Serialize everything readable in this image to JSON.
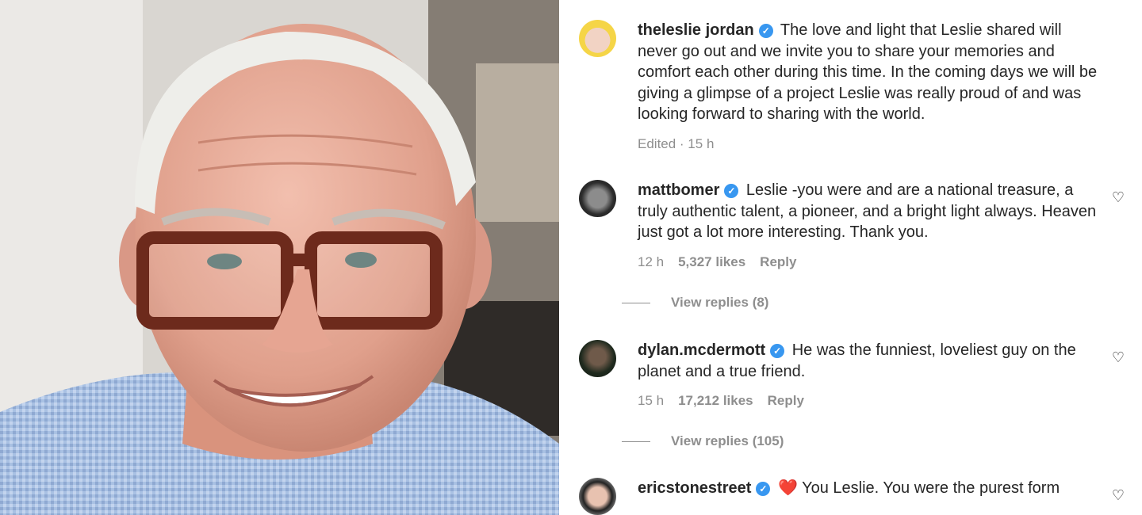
{
  "comments": [
    {
      "username": "theleslie jordan",
      "text": "The love and light that Leslie shared will never go out and we invite you to share your memories and comfort each other during this time. In the coming days we will be giving a glimpse of a project Leslie was really proud of and was looking forward to sharing with the world.",
      "edited": "Edited · 15 h"
    },
    {
      "username": "mattbomer",
      "text": "Leslie -you were and are a national treasure, a truly authentic talent, a pioneer, and a bright light always. Heaven just got a lot more interesting. Thank you.",
      "time": "12 h",
      "likes": "5,327 likes",
      "reply": "Reply",
      "view_replies": "View replies (8)"
    },
    {
      "username": "dylan.mcdermott",
      "text": "He was the funniest, loveliest guy on the planet and a true friend.",
      "time": "15 h",
      "likes": "17,212 likes",
      "reply": "Reply",
      "view_replies": "View replies (105)"
    },
    {
      "username": "ericstonestreet",
      "emoji": "❤️",
      "text": "You Leslie. You were the purest form"
    }
  ],
  "icons": {
    "verified": "verified-badge-icon",
    "like": "heart-outline-icon"
  },
  "colors": {
    "verified": "#3897f0",
    "muted": "#8e8e8e",
    "text": "#262626"
  }
}
